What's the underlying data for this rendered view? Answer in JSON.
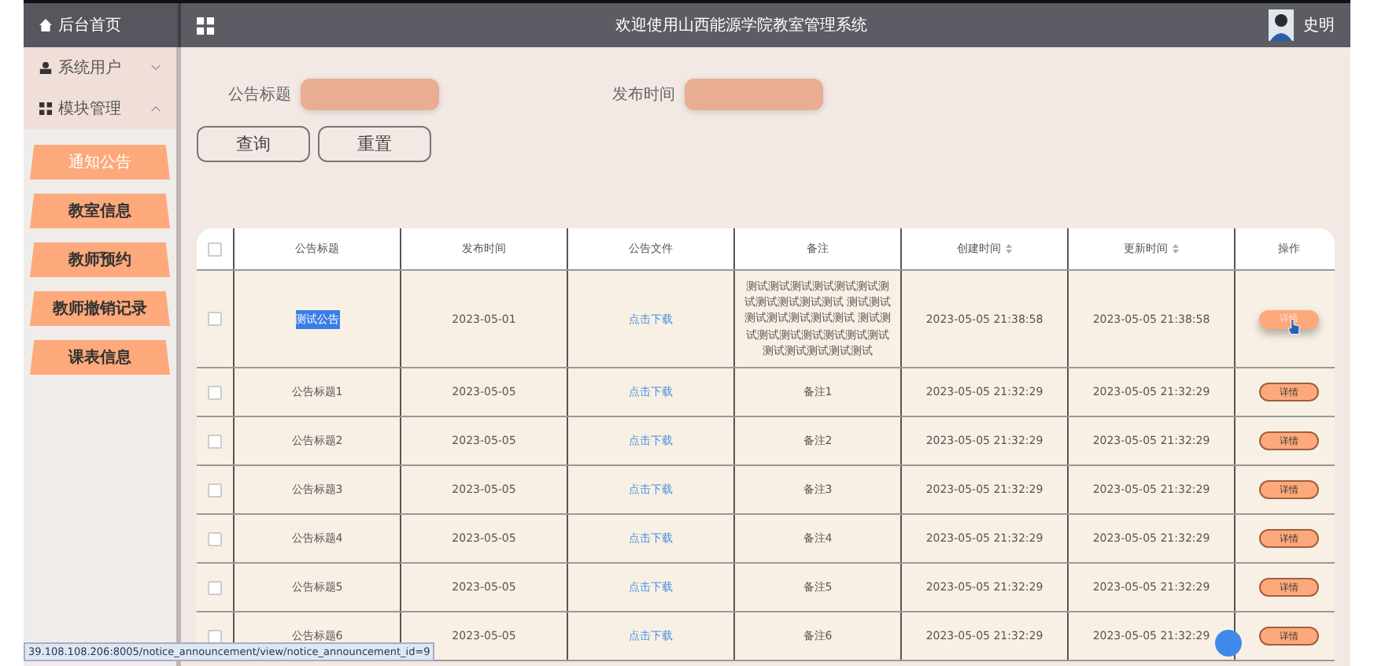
{
  "header": {
    "home": "后台首页",
    "title": "欢迎使用山西能源学院教室管理系统",
    "user": "史明"
  },
  "sidebar": {
    "groups": [
      {
        "label": "系统用户",
        "expanded": false
      },
      {
        "label": "模块管理",
        "expanded": true,
        "children": [
          {
            "label": "通知公告",
            "selected": true
          },
          {
            "label": "教室信息",
            "selected": false
          },
          {
            "label": "教师预约",
            "selected": false
          },
          {
            "label": "教师撤销记录",
            "selected": false
          },
          {
            "label": "课表信息",
            "selected": false
          }
        ]
      }
    ]
  },
  "filters": [
    {
      "label": "公告标题"
    },
    {
      "label": "发布时间"
    }
  ],
  "buttons": [
    "查询",
    "重置"
  ],
  "table": {
    "all_checked": false,
    "columns": [
      {
        "label": "公告标题",
        "sortable": false
      },
      {
        "label": "发布时间",
        "sortable": false
      },
      {
        "label": "公告文件",
        "sortable": false
      },
      {
        "label": "备注",
        "sortable": false
      },
      {
        "label": "创建时间",
        "sortable": true
      },
      {
        "label": "更新时间",
        "sortable": true
      },
      {
        "label": "操作",
        "sortable": false
      }
    ],
    "rows": [
      {
        "checked": false,
        "title": "测试公告",
        "title_selected": true,
        "date": "2023-05-01",
        "file": "点击下载",
        "remark": "测试测试测试测试测试测试测试测试测试测试测试 测试测试测试测试测试测试测试 测试测试测试测试测试测试测试测试测试测试测试测试测试",
        "created": "2023-05-05 21:38:58",
        "updated": "2023-05-05 21:38:58",
        "action": "详情",
        "hovered": true
      },
      {
        "checked": false,
        "title": "公告标题1",
        "title_selected": false,
        "date": "2023-05-05",
        "file": "点击下载",
        "remark": "备注1",
        "created": "2023-05-05 21:32:29",
        "updated": "2023-05-05 21:32:29",
        "action": "详情",
        "hovered": false
      },
      {
        "checked": false,
        "title": "公告标题2",
        "title_selected": false,
        "date": "2023-05-05",
        "file": "点击下载",
        "remark": "备注2",
        "created": "2023-05-05 21:32:29",
        "updated": "2023-05-05 21:32:29",
        "action": "详情",
        "hovered": false
      },
      {
        "checked": false,
        "title": "公告标题3",
        "title_selected": false,
        "date": "2023-05-05",
        "file": "点击下载",
        "remark": "备注3",
        "created": "2023-05-05 21:32:29",
        "updated": "2023-05-05 21:32:29",
        "action": "详情",
        "hovered": false
      },
      {
        "checked": false,
        "title": "公告标题4",
        "title_selected": false,
        "date": "2023-05-05",
        "file": "点击下载",
        "remark": "备注4",
        "created": "2023-05-05 21:32:29",
        "updated": "2023-05-05 21:32:29",
        "action": "详情",
        "hovered": false
      },
      {
        "checked": false,
        "title": "公告标题5",
        "title_selected": false,
        "date": "2023-05-05",
        "file": "点击下载",
        "remark": "备注5",
        "created": "2023-05-05 21:32:29",
        "updated": "2023-05-05 21:32:29",
        "action": "详情",
        "hovered": false
      },
      {
        "checked": false,
        "title": "公告标题6",
        "title_selected": false,
        "date": "2023-05-05",
        "file": "点击下载",
        "remark": "备注6",
        "created": "2023-05-05 21:32:29",
        "updated": "2023-05-05 21:32:29",
        "action": "详情",
        "hovered": false
      }
    ]
  },
  "status_url": "39.108.108.206:8005/notice_announcement/view/notice_announcement_id=9"
}
